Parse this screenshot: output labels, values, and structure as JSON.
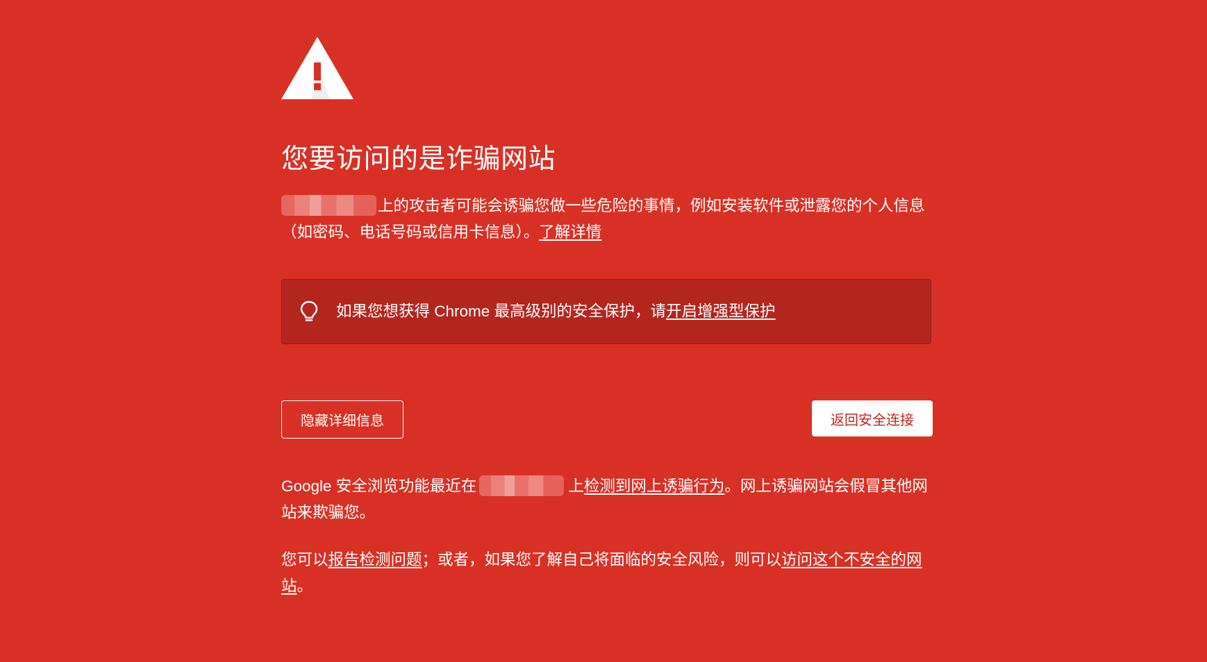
{
  "title": "您要访问的是诈骗网站",
  "intro": {
    "text": "上的攻击者可能会诱骗您做一些危险的事情，例如安装软件或泄露您的个人信息（如密码、电话号码或信用卡信息）。",
    "learn_more_link": "了解详情"
  },
  "tip": {
    "text": "如果您想获得 Chrome 最高级别的安全保护，请",
    "link": "开启增强型保护"
  },
  "buttons": {
    "hide_details": "隐藏详细信息",
    "back_to_safety": "返回安全连接"
  },
  "details": {
    "p1_prefix": "Google 安全浏览功能最近在",
    "p1_mid": "上",
    "p1_link": "检测到网上诱骗行为",
    "p1_suffix": "。网上诱骗网站会假冒其他网站来欺骗您。",
    "p2_prefix": "您可以",
    "p2_report_link": "报告检测问题",
    "p2_mid": "；或者，如果您了解自己将面临的安全风险，则可以",
    "p2_visit_link": "访问这个不安全的网站",
    "p2_suffix": "。"
  },
  "icons": {
    "warning": "warning-triangle-icon",
    "tip": "lightbulb-icon"
  },
  "colors": {
    "background": "#d93025",
    "tip_background": "#b3261e",
    "button_text": "#c5221f"
  }
}
